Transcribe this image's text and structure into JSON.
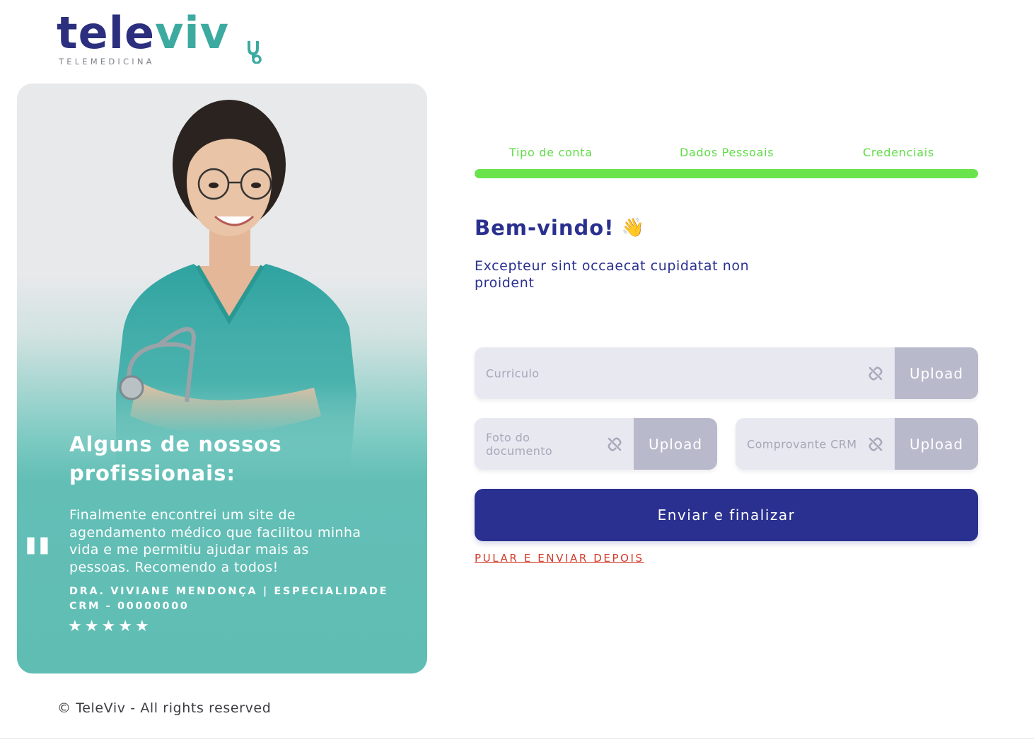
{
  "brand": {
    "name_part1": "tele",
    "name_part2": "viv",
    "subtitle": "TELEMEDICINA",
    "primary_color": "#29308f",
    "accent_color": "#3daaa0"
  },
  "testimonial": {
    "heading": "Alguns de nossos\nprofissionais:",
    "quote_icon": "quote-icon",
    "quote": "Finalmente encontrei um site de agendamento médico que facilitou minha vida e me permitiu ajudar mais as pessoas. Recomendo a todos!",
    "author": "Dra. Viviane Mendonça | Especialidade",
    "crm": "CRM - 00000000",
    "rating": 5,
    "card_color": "#60bdb4"
  },
  "footer": {
    "copyright": "© TeleViv - All rights reserved"
  },
  "steps": {
    "items": [
      {
        "label": "Tipo de conta"
      },
      {
        "label": "Dados Pessoais"
      },
      {
        "label": "Credenciais"
      }
    ],
    "progress_percent": 100,
    "color": "#6ae34d"
  },
  "form": {
    "title": "Bem-vindo!",
    "title_emoji": "👋",
    "subtitle": "Excepteur sint occaecat cupidatat non proident",
    "fields": {
      "curriculo": {
        "placeholder": "Curriculo",
        "button": "Upload",
        "icon": "unlink-icon"
      },
      "foto": {
        "placeholder": "Foto do documento",
        "button": "Upload",
        "icon": "unlink-icon"
      },
      "crm": {
        "placeholder": "Comprovante CRM",
        "button": "Upload",
        "icon": "unlink-icon"
      }
    },
    "submit_label": "Enviar e finalizar",
    "skip_label": "PULAR E ENVIAR DEPOIS",
    "skip_color": "#d23a2a"
  }
}
